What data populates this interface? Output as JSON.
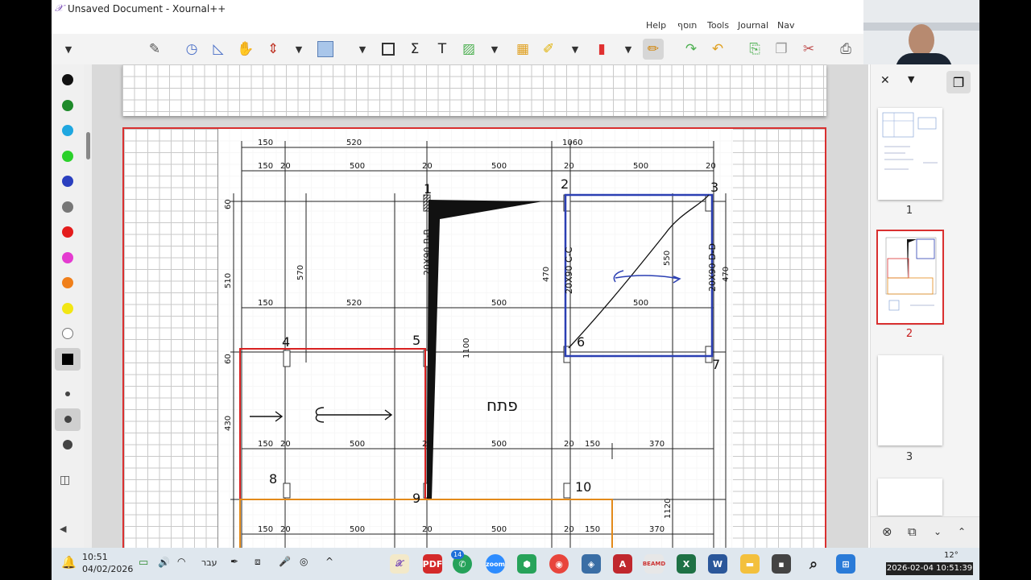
{
  "window": {
    "title": "Unsaved Document - Xournal++"
  },
  "menu": [
    "Help",
    "תוסף",
    "Tools",
    "Journal",
    "Nav"
  ],
  "tool_colors": [
    "#111111",
    "#1e8a2a",
    "#1fa7e0",
    "#2bd12b",
    "#2a3fbf",
    "#777777",
    "#e41c1c",
    "#e43bd0",
    "#f07f1a",
    "#f2e614",
    "#ffffff",
    "#000000"
  ],
  "plan": {
    "hebrew_label": "פתח",
    "nodes": [
      "1",
      "2",
      "3",
      "4",
      "5",
      "6",
      "7",
      "8",
      "9",
      "10"
    ],
    "beams": [
      "20X90 B-B",
      "20X90 C-C",
      "20X90 D-D"
    ],
    "dims_row1": [
      "150",
      "520",
      "1060"
    ],
    "dims_row2": [
      "150",
      "20",
      "500",
      "20",
      "500",
      "20",
      "500",
      "20"
    ],
    "dims_left": [
      "60",
      "510",
      "570",
      "60",
      "430"
    ],
    "dims_mid": [
      "150",
      "520",
      "500",
      "500"
    ],
    "dims_lower": [
      "150",
      "20",
      "500",
      "20",
      "500",
      "20",
      "150",
      "370"
    ],
    "dims_bottom": [
      "150",
      "20",
      "500",
      "20",
      "500",
      "20",
      "150",
      "370"
    ],
    "misc": [
      "470",
      "470",
      "1100",
      "550",
      "1120",
      "60",
      "20"
    ]
  },
  "pages": [
    {
      "number": "1"
    },
    {
      "number": "2"
    },
    {
      "number": "3"
    }
  ],
  "taskbar": {
    "time": "10:51",
    "date": "04/02/2026",
    "lang": "עבר",
    "badge": "14",
    "weather": "12°",
    "timestamp": "2026-02-04  10:51:39"
  }
}
